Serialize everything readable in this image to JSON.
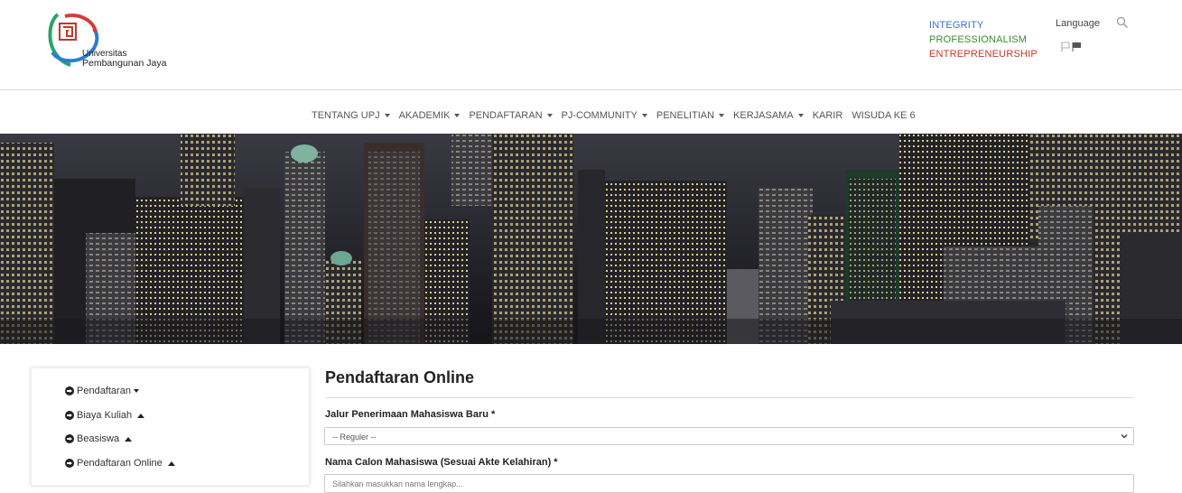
{
  "header": {
    "logo_line1": "Universitas",
    "logo_line2": "Pembangunan Jaya",
    "values": [
      "INTEGRITY",
      "PROFESSIONALISM",
      "ENTREPRENEURSHIP"
    ],
    "language_label": "Language",
    "colors": {
      "integrity": "#3a6fc4",
      "professionalism": "#3c8a2f",
      "entrepreneurship": "#c0392b"
    }
  },
  "nav": {
    "items": [
      {
        "label": "TENTANG UPJ",
        "has_dropdown": true
      },
      {
        "label": "AKADEMIK",
        "has_dropdown": true
      },
      {
        "label": "PENDAFTARAN",
        "has_dropdown": true
      },
      {
        "label": "PJ-COMMUNITY",
        "has_dropdown": true
      },
      {
        "label": "PENELITIAN",
        "has_dropdown": true
      },
      {
        "label": "KERJASAMA",
        "has_dropdown": true
      },
      {
        "label": "KARIR",
        "has_dropdown": false
      },
      {
        "label": "WISUDA KE 6",
        "has_dropdown": false
      }
    ]
  },
  "sidebar": {
    "items": [
      {
        "label": "Pendaftaran",
        "icon": "arrow-circle-right-icon",
        "toggle": "caret-down"
      },
      {
        "label": "Biaya Kuliah",
        "icon": "arrow-circle-right-icon",
        "toggle": "caret-up"
      },
      {
        "label": "Beasiswa",
        "icon": "arrow-circle-right-icon",
        "toggle": "caret-up"
      },
      {
        "label": "Pendaftaran Online",
        "icon": "arrow-circle-right-icon",
        "toggle": "caret-up"
      }
    ]
  },
  "form": {
    "title": "Pendaftaran Online",
    "jalur_label": "Jalur Penerimaan Mahasiswa Baru *",
    "jalur_value": "-- Reguler --",
    "nama_label": "Nama Calon Mahasiswa (Sesuai Akte Kelahiran) *",
    "nama_placeholder": "Silahkan masukkan nama lengkap..."
  }
}
